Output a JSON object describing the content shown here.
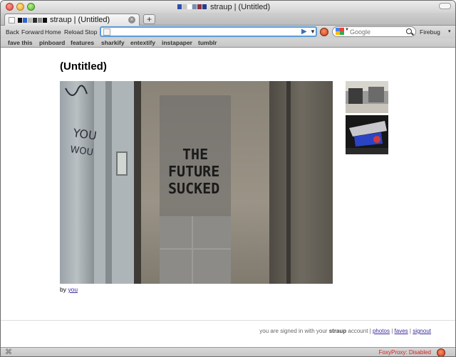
{
  "window": {
    "title": "straup | (Untitled)",
    "favicon_colors": [
      "#2b4fa8",
      "#c7c7c7",
      "#fdfdfd",
      "#7b8fb1",
      "#8f2e3e",
      "#273a8f"
    ]
  },
  "tab": {
    "title": "straup | (Untitled)",
    "swatch_colors": [
      "#111111",
      "#2f63c9",
      "#b9b9b9",
      "#2d2d2d",
      "#8c8c8c",
      "#0e0e0e"
    ],
    "close_glyph": "×",
    "new_tab_glyph": "+"
  },
  "nav": {
    "back": "Back",
    "forward": "Forward",
    "home": "Home",
    "reload": "Reload",
    "stop": "Stop",
    "url_value": "",
    "go_glyph": "▶",
    "dropdown_glyph": "▼",
    "search_placeholder": "Google",
    "search_engine_colors": [
      "#4285f4",
      "#ea4335",
      "#fbbc05",
      "#34a853"
    ],
    "firebug": "Firebug",
    "firebug_arrow": "▾"
  },
  "bookmarks": [
    "fave this",
    "pinboard",
    "features",
    "sharkify",
    "entextify",
    "instapaper",
    "tumblr"
  ],
  "page": {
    "title": "(Untitled)",
    "by_prefix": "by",
    "by_link": "you",
    "photo_graffiti": [
      "THE",
      "FUTURE",
      "SUCKED"
    ],
    "photo_scrawl": [
      "YOU",
      "WOU"
    ]
  },
  "footer": {
    "prefix": "you are signed in with your",
    "account": "straup",
    "suffix": "account |",
    "links": [
      "photos",
      "faves",
      "signout"
    ],
    "separator": "|"
  },
  "status": {
    "left_glyph": "⌘",
    "foxyproxy": "FoxyProxy: Disabled"
  },
  "colors": {
    "accent": "#5b9bd8",
    "link": "#3a2c9a",
    "status_warning": "#d61f1f"
  }
}
